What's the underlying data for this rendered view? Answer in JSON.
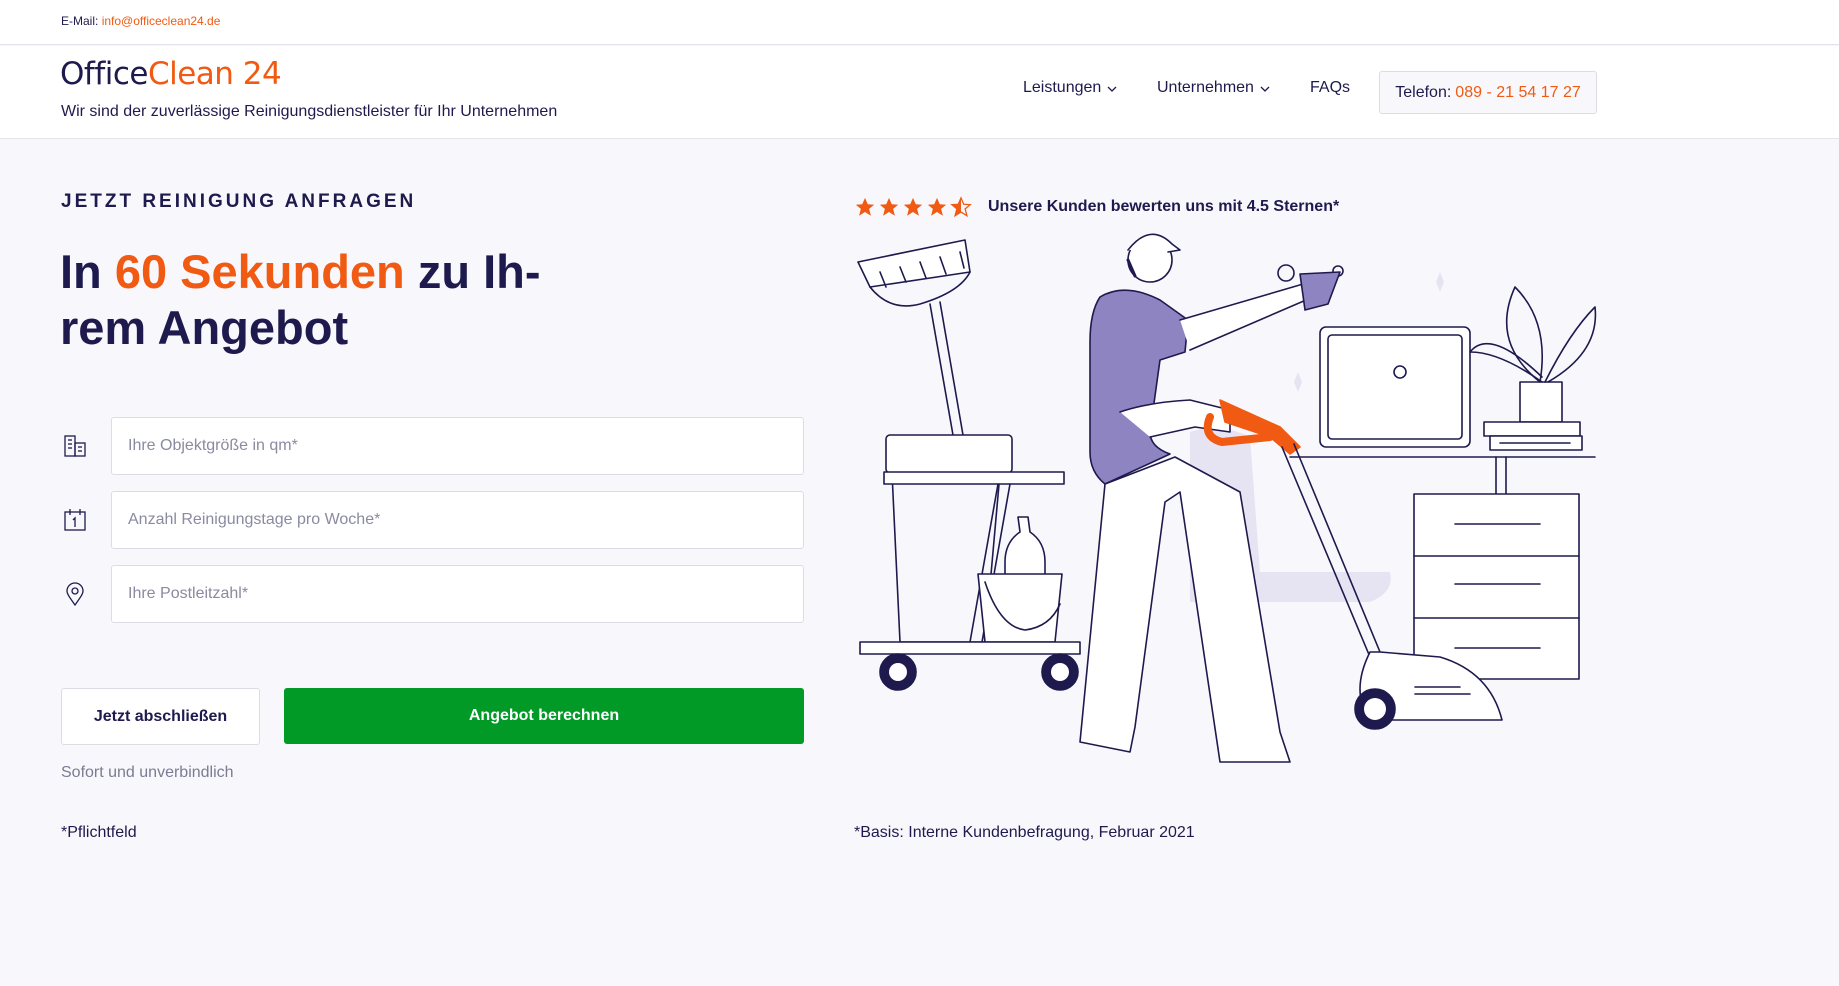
{
  "topbar": {
    "email_label": "E-Mail:",
    "email_address": "info@officeclean24.de"
  },
  "header": {
    "logo_office": "Office",
    "logo_clean": "Clean 24",
    "tagline": "Wir sind der zuverlässige Reinigungsdienstleister für Ihr Unternehmen",
    "nav": [
      {
        "label": "Leistungen",
        "icon": "chevron-down-icon"
      },
      {
        "label": "Unternehmen",
        "icon": "chevron-down-icon"
      },
      {
        "label": "FAQs"
      }
    ],
    "phone_label": "Telefon:",
    "phone_number": "089 - 21 54 17 27"
  },
  "hero": {
    "kicker": "JETZT REINIGUNG ANFRAGEN",
    "headline_before": "In ",
    "headline_highlight": "60 Sekunden",
    "headline_after": " zu Ih-rem Angebot"
  },
  "form": {
    "fields": [
      {
        "placeholder": "Ihre Objektgröße in qm*",
        "value": "",
        "icon": "building-icon"
      },
      {
        "placeholder": "Anzahl Reinigungstage pro Woche*",
        "value": "",
        "icon": "calendar-icon"
      },
      {
        "placeholder": "Ihre Postleitzahl*",
        "value": "",
        "icon": "location-pin-icon"
      }
    ],
    "secondary_button": "Jetzt abschließen",
    "primary_button": "Angebot berechnen",
    "note": "Sofort und unverbindlich",
    "required_note": "*Pflichtfeld"
  },
  "rating": {
    "stars": 4.5,
    "text": "Unsere Kunden bewerten uns mit 4.5 Sternen*"
  },
  "footnote": "*Basis: Interne Kundenbefragung, Februar 2021",
  "colors": {
    "accent": "#f05a12",
    "navy": "#1e1a4d",
    "primary_button": "#019a26",
    "illustration_purple": "#8f84c2"
  }
}
